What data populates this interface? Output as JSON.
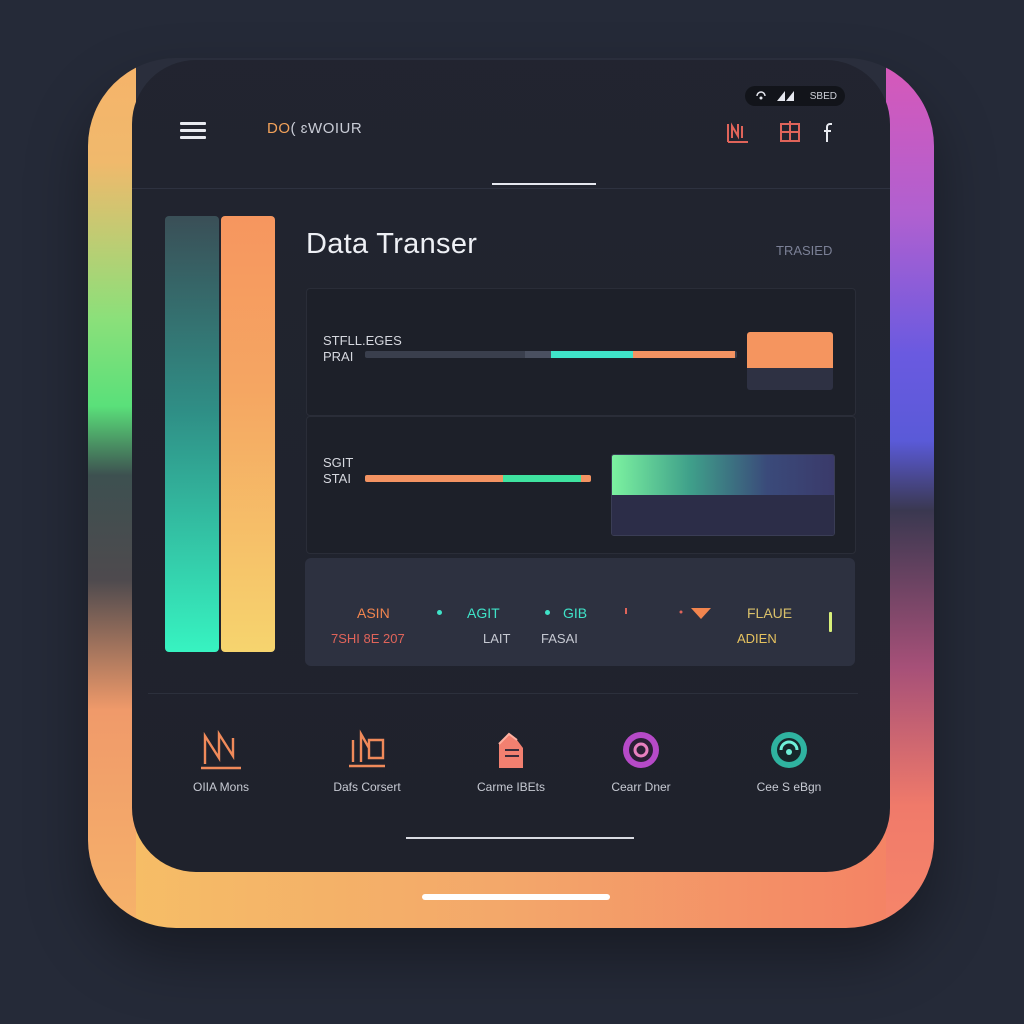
{
  "status": {
    "battery": "SBED"
  },
  "header": {
    "brand_prefix": "DO",
    "brand_rest": "( ɛWOIUR",
    "icons": [
      "chart-icon",
      "grid-window-icon",
      "facebook-icon"
    ]
  },
  "main": {
    "title": "Data Transer",
    "title_tag": "TRASIED"
  },
  "card1": {
    "label_line1": "STFLL.EGES",
    "label_line2": "PRAI",
    "progress_segments": [
      {
        "color": "#3a3f4d"
      },
      {
        "color": "#4a5060"
      },
      {
        "color": "#3fe3c8"
      },
      {
        "color": "#f39362"
      }
    ]
  },
  "card2": {
    "label_line1": "SGIT",
    "label_line2": "STAI",
    "progress_segments": [
      {
        "color": "#f39362"
      },
      {
        "color": "#3fe3a0"
      }
    ]
  },
  "stats": [
    {
      "top": "ASIN",
      "bottom": "7SHI 8E 207",
      "top_color": "#f2854e",
      "bottom_color": "#e0645a"
    },
    {
      "top": "AGIT",
      "bottom": "LAIT",
      "top_color": "#3fe3c8",
      "bottom_color": "#c6c9d2"
    },
    {
      "top": "GIB",
      "bottom": "FASAI",
      "top_color": "#3fe3c8",
      "bottom_color": "#c6c9d2"
    },
    {
      "top": "FLAUE",
      "bottom": "ADIEN",
      "top_color": "#d9c06a",
      "bottom_color": "#e6c25f"
    }
  ],
  "nav": [
    {
      "label": "OIIA Mons",
      "icon": "line-chart-icon"
    },
    {
      "label": "Dafs Corsert",
      "icon": "bar-chart-icon"
    },
    {
      "label": "Carme IBEts",
      "icon": "hand-icon"
    },
    {
      "label": "Cearr Dner",
      "icon": "ring-icon"
    },
    {
      "label": "Cee S eBgn",
      "icon": "swirl-icon"
    }
  ],
  "colors": {
    "accent_orange": "#f3a25a",
    "accent_teal": "#3fe3c8",
    "accent_red": "#e0645a",
    "background": "#20232d"
  }
}
